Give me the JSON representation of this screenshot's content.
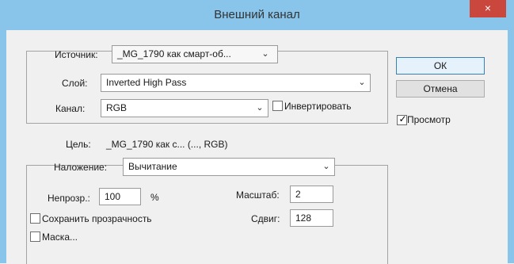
{
  "window": {
    "title": "Внешний канал",
    "close_glyph": "×"
  },
  "source": {
    "label": "Источник:",
    "value": "_MG_1790 как смарт-об..."
  },
  "layer": {
    "label": "Слой:",
    "value": "Inverted High Pass"
  },
  "channel": {
    "label": "Канал:",
    "value": "RGB",
    "invert_label": "Инвертировать",
    "invert_checked": false
  },
  "target": {
    "label": "Цель:",
    "value": "_MG_1790 как с... (..., RGB)"
  },
  "blending": {
    "label": "Наложение:",
    "value": "Вычитание"
  },
  "opacity": {
    "label": "Непрозр.:",
    "value": "100",
    "unit": "%"
  },
  "scale": {
    "label": "Масштаб:",
    "value": "2"
  },
  "offset": {
    "label": "Сдвиг:",
    "value": "128"
  },
  "options": {
    "preserve_transparency_label": "Сохранить прозрачность",
    "preserve_transparency_checked": false,
    "mask_label": "Маска...",
    "mask_checked": false
  },
  "buttons": {
    "ok_label": "ОК",
    "cancel_label": "Отмена"
  },
  "preview": {
    "label": "Просмотр",
    "checked": true
  },
  "icons": {
    "chevron": "chevron-down-icon",
    "close": "close-icon",
    "checkmark": "checkmark-icon"
  },
  "colors": {
    "title_bar": "#89c4ea",
    "close_button": "#c9473d",
    "dialog_bg": "#f0f0f0"
  }
}
